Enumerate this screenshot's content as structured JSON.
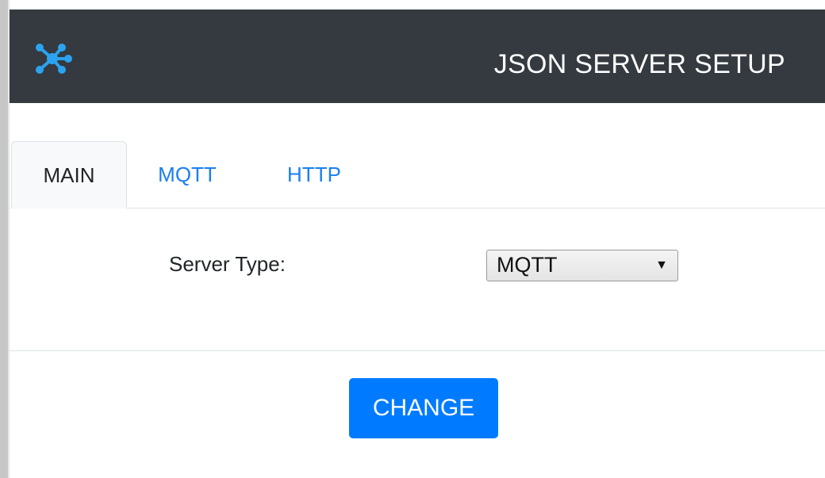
{
  "header": {
    "title": "JSON SERVER SETUP",
    "logo_icon": "network-nodes-icon",
    "logo_color": "#2ba3f0",
    "background_color": "#343a40"
  },
  "tabs": [
    {
      "label": "MAIN",
      "active": true
    },
    {
      "label": "MQTT",
      "active": false
    },
    {
      "label": "HTTP",
      "active": false
    }
  ],
  "main": {
    "server_type_label": "Server Type:",
    "server_type_select": {
      "selected": "MQTT",
      "arrow_icon": "triangle-down-icon"
    }
  },
  "footer": {
    "change_button_label": "CHANGE",
    "accent_color": "#007bff"
  }
}
